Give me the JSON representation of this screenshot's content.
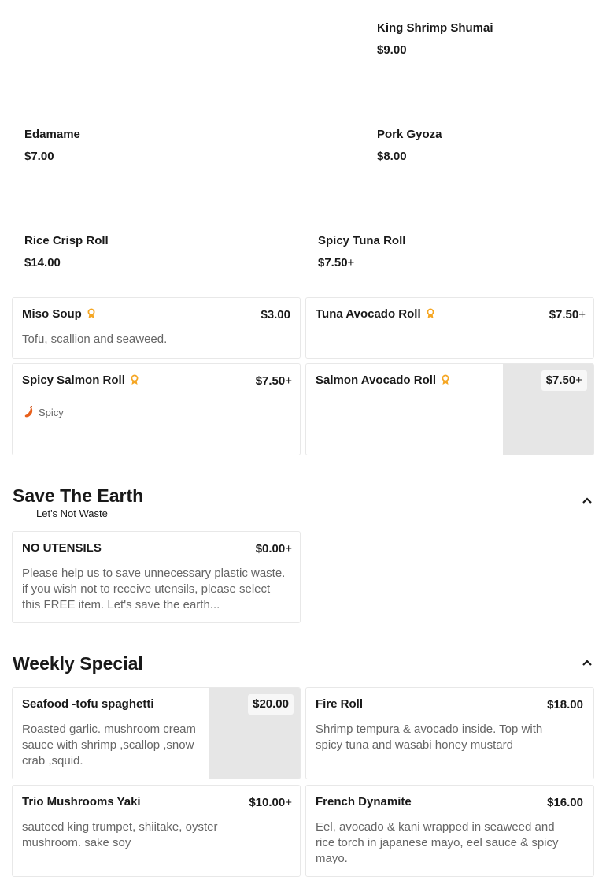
{
  "featured": [
    {
      "name": "King Shrimp Shumai",
      "price": "$9.00",
      "plus": ""
    },
    {
      "name": "Edamame",
      "price": "$7.00",
      "plus": ""
    },
    {
      "name": "Pork Gyoza",
      "price": "$8.00",
      "plus": ""
    },
    {
      "name": "Rice Crisp Roll",
      "price": "$14.00",
      "plus": ""
    },
    {
      "name": "Spicy Tuna Roll",
      "price": "$7.50",
      "plus": "+"
    }
  ],
  "popular_items": [
    {
      "name": "Miso Soup",
      "price": "$3.00",
      "plus": "",
      "description": "Tofu, scallion and seaweed.",
      "badge_icon": "award-ribbon-icon"
    },
    {
      "name": "Tuna Avocado Roll",
      "price": "$7.50",
      "plus": "+",
      "badge_icon": "award-ribbon-icon"
    },
    {
      "name": "Spicy Salmon Roll",
      "price": "$7.50",
      "plus": "+",
      "tag": "Spicy",
      "tag_icon": "chili-pepper-icon",
      "badge_icon": "award-ribbon-icon"
    },
    {
      "name": "Salmon Avocado Roll",
      "price": "$7.50",
      "plus": "+",
      "badge_icon": "award-ribbon-icon"
    }
  ],
  "sections": {
    "save_earth": {
      "title": "Save The Earth",
      "subtitle": "Let's Not Waste",
      "items": [
        {
          "name": "NO UTENSILS",
          "price": "$0.00",
          "plus": "+",
          "description": "Please help us to save unnecessary plastic waste. if you wish not to receive utensils, please select this FREE item. Let's save the earth..."
        }
      ]
    },
    "weekly_special": {
      "title": "Weekly Special",
      "items": [
        {
          "name": "Seafood -tofu spaghetti",
          "price": "$20.00",
          "plus": "",
          "description": "Roasted garlic. mushroom cream sauce with shrimp ,scallop ,snow crab ,squid."
        },
        {
          "name": "Fire Roll",
          "price": "$18.00",
          "plus": "",
          "description": "Shrimp tempura & avocado inside. Top with spicy tuna and wasabi honey mustard"
        },
        {
          "name": "Trio Mushrooms Yaki",
          "price": "$10.00",
          "plus": "+",
          "description": "sauteed king trumpet, shiitake, oyster mushroom. sake soy"
        },
        {
          "name": "French Dynamite",
          "price": "$16.00",
          "plus": "",
          "description": "Eel, avocado & kani wrapped in seaweed and rice torch in japanese mayo, eel sauce & spicy mayo."
        }
      ]
    }
  },
  "colors": {
    "badge": "#f5a623",
    "spicy": "#e8601c",
    "text": "#191919",
    "muted": "#666666",
    "image_placeholder": "#e6e6e6"
  },
  "icons": {
    "collapse": "chevron-up-icon"
  }
}
